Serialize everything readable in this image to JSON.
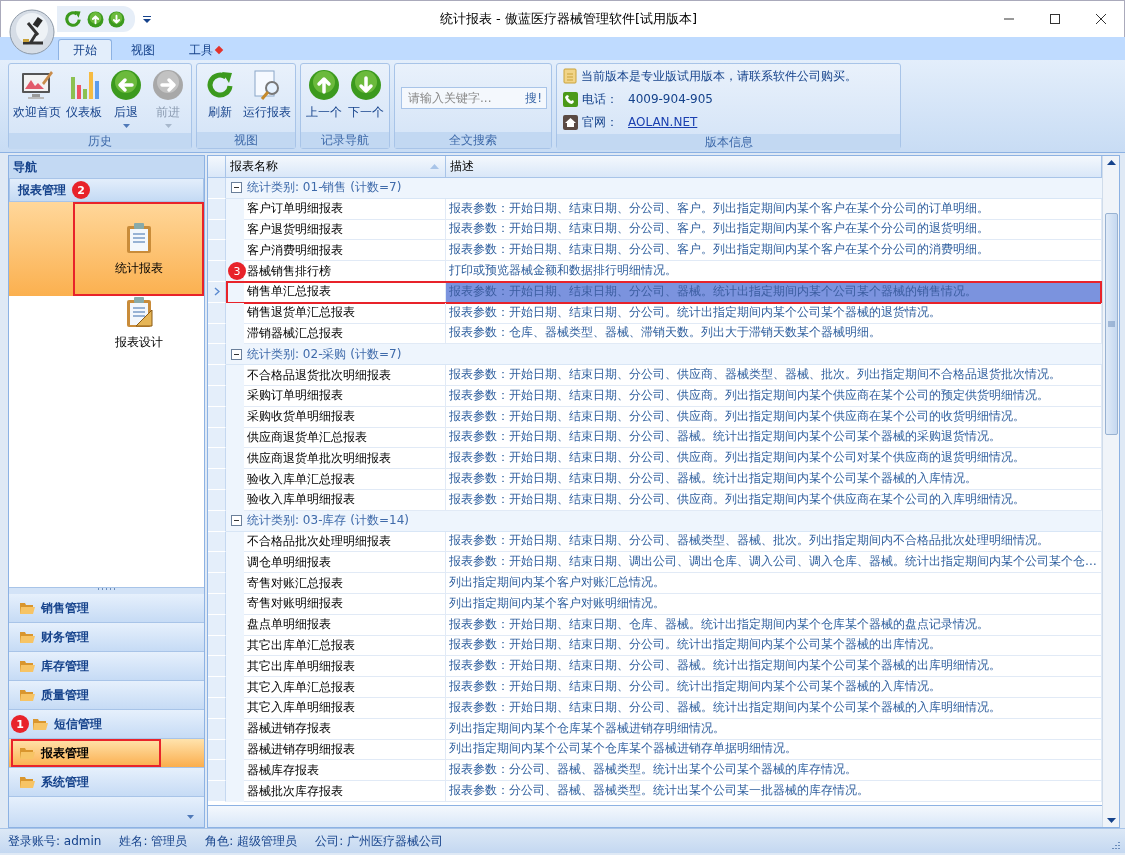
{
  "window": {
    "title": "统计报表 - 傲蓝医疗器械管理软件[试用版本]"
  },
  "ribbon": {
    "tabs": [
      {
        "label": "开始",
        "selected": true,
        "dot": false
      },
      {
        "label": "视图",
        "selected": false,
        "dot": false
      },
      {
        "label": "工具",
        "selected": false,
        "dot": true
      }
    ],
    "groups": [
      {
        "caption": "历史",
        "buttons": [
          {
            "label": "欢迎首页",
            "disabled": false,
            "dropdown": false
          },
          {
            "label": "仪表板",
            "disabled": false,
            "dropdown": false
          },
          {
            "label": "后退",
            "disabled": false,
            "dropdown": true
          },
          {
            "label": "前进",
            "disabled": true,
            "dropdown": true
          }
        ]
      },
      {
        "caption": "视图",
        "buttons": [
          {
            "label": "刷新",
            "disabled": false,
            "dropdown": false
          },
          {
            "label": "运行报表",
            "disabled": false,
            "dropdown": false
          }
        ]
      },
      {
        "caption": "记录导航",
        "buttons": [
          {
            "label": "上一个",
            "disabled": false,
            "dropdown": false
          },
          {
            "label": "下一个",
            "disabled": false,
            "dropdown": false
          }
        ]
      }
    ],
    "search": {
      "caption": "全文搜索",
      "placeholder": "请输入关键字...",
      "button": "搜!"
    },
    "version_info": {
      "caption": "版本信息",
      "message": "当前版本是专业版试用版本，请联系软件公司购买。",
      "phone_label": "电话：",
      "phone": "4009-904-905",
      "website_label": "官网：",
      "website": "AOLAN.NET"
    }
  },
  "navigation": {
    "title": "导航",
    "group": {
      "label": "报表管理",
      "badge": "2"
    },
    "items": [
      {
        "label": "统计报表",
        "selected": true,
        "highlighted": true
      },
      {
        "label": "报表设计",
        "selected": false,
        "highlighted": false
      }
    ],
    "modules": [
      {
        "label": "销售管理",
        "selected": false,
        "highlighted": false
      },
      {
        "label": "财务管理",
        "selected": false,
        "highlighted": false
      },
      {
        "label": "库存管理",
        "selected": false,
        "highlighted": false
      },
      {
        "label": "质量管理",
        "selected": false,
        "highlighted": false
      },
      {
        "label": "短信管理",
        "selected": false,
        "highlighted": false,
        "badge": "1"
      },
      {
        "label": "报表管理",
        "selected": true,
        "highlighted": true
      },
      {
        "label": "系统管理",
        "selected": false,
        "highlighted": false
      }
    ]
  },
  "table": {
    "columns": [
      "报表名称",
      "描述"
    ],
    "groups": [
      {
        "label": "统计类别: 01-销售 (计数=7)",
        "expanded": true,
        "rows": [
          {
            "name": "客户订单明细报表",
            "description": "报表参数：开始日期、结束日期、分公司、客户。列出指定期间内某个客户在某个分公司的订单明细。",
            "selected": false,
            "highlighted": false
          },
          {
            "name": "客户退货明细报表",
            "description": "报表参数：开始日期、结束日期、分公司、客户。列出指定期间内某个客户在某个分公司的退货明细。",
            "selected": false,
            "highlighted": false
          },
          {
            "name": "客户消费明细报表",
            "description": "报表参数：开始日期、结束日期、分公司、客户。列出指定期间内某个客户在某个分公司的消费明细。",
            "selected": false,
            "highlighted": false
          },
          {
            "name": "器械销售排行榜",
            "description": "打印或预览器械金额和数据排行明细情况。",
            "selected": false,
            "highlighted": false,
            "badge": "3"
          },
          {
            "name": "销售单汇总报表",
            "description": "报表参数：开始日期、结束日期、分公司、器械。统计出指定期间内某个公司某个器械的销售情况。",
            "selected": true,
            "highlighted": true
          },
          {
            "name": "销售退货单汇总报表",
            "description": "报表参数：开始日期、结束日期、分公司。统计出指定期间内某个公司某个器械的退货情况。",
            "selected": false,
            "highlighted": false
          },
          {
            "name": "滞销器械汇总报表",
            "description": "报表参数：仓库、器械类型、器械、滞销天数。列出大于滞销天数某个器械明细。",
            "selected": false,
            "highlighted": false
          }
        ]
      },
      {
        "label": "统计类别: 02-采购 (计数=7)",
        "expanded": true,
        "rows": [
          {
            "name": "不合格品退货批次明细报表",
            "description": "报表参数：开始日期、结束日期、分公司、供应商、器械类型、器械、批次。列出指定期间不合格品退货批次情况。",
            "selected": false,
            "highlighted": false
          },
          {
            "name": "采购订单明细报表",
            "description": "报表参数：开始日期、结束日期、分公司、供应商。列出指定期间内某个供应商在某个公司的预定供货明细情况。",
            "selected": false,
            "highlighted": false
          },
          {
            "name": "采购收货单明细报表",
            "description": "报表参数：开始日期、结束日期、分公司、供应商。列出指定期间内某个供应商在某个公司的收货明细情况。",
            "selected": false,
            "highlighted": false
          },
          {
            "name": "供应商退货单汇总报表",
            "description": "报表参数：开始日期、结束日期、分公司、器械。统计出指定期间内某个公司某个器械的采购退货情况。",
            "selected": false,
            "highlighted": false
          },
          {
            "name": "供应商退货单批次明细报表",
            "description": "报表参数：开始日期、结束日期、分公司、供应商。列出指定期间内某个公司对某个供应商的退货明细情况。",
            "selected": false,
            "highlighted": false
          },
          {
            "name": "验收入库单汇总报表",
            "description": "报表参数：开始日期、结束日期、分公司、器械。统计出指定期间内某个公司某个器械的入库情况。",
            "selected": false,
            "highlighted": false
          },
          {
            "name": "验收入库单明细报表",
            "description": "报表参数：开始日期、结束日期、分公司、供应商。列出指定期间内某个供应商在某个公司的入库明细情况。",
            "selected": false,
            "highlighted": false
          }
        ]
      },
      {
        "label": "统计类别: 03-库存 (计数=14)",
        "expanded": true,
        "rows": [
          {
            "name": "不合格品批次处理明细报表",
            "description": "报表参数：开始日期、结束日期、分公司、器械类型、器械、批次。列出指定期间内不合格品批次处理明细情况。",
            "selected": false,
            "highlighted": false
          },
          {
            "name": "调仓单明细报表",
            "description": "报表参数：开始日期、结束日期、调出公司、调出仓库、调入公司、调入仓库、器械。统计出指定期间内某个公司某个仓…",
            "selected": false,
            "highlighted": false
          },
          {
            "name": "寄售对账汇总报表",
            "description": "列出指定期间内某个客户对账汇总情况。",
            "selected": false,
            "highlighted": false
          },
          {
            "name": "寄售对账明细报表",
            "description": "列出指定期间内某个客户对账明细情况。",
            "selected": false,
            "highlighted": false
          },
          {
            "name": "盘点单明细报表",
            "description": "报表参数：开始日期、结束日期、仓库、器械。统计出指定期间内某个仓库某个器械的盘点记录情况。",
            "selected": false,
            "highlighted": false
          },
          {
            "name": "其它出库单汇总报表",
            "description": "报表参数：开始日期、结束日期、分公司。统计出指定期间内某个公司某个器械的出库情况。",
            "selected": false,
            "highlighted": false
          },
          {
            "name": "其它出库单明细报表",
            "description": "报表参数：开始日期、结束日期、分公司、器械。统计出指定期间内某个公司某个器械的出库明细情况。",
            "selected": false,
            "highlighted": false
          },
          {
            "name": "其它入库单汇总报表",
            "description": "报表参数：开始日期、结束日期、分公司。统计出指定期间内某个公司某个器械的入库情况。",
            "selected": false,
            "highlighted": false
          },
          {
            "name": "其它入库单明细报表",
            "description": "报表参数：开始日期、结束日期、分公司、器械。统计出指定期间内某个公司某个器械的入库明细情况。",
            "selected": false,
            "highlighted": false
          },
          {
            "name": "器械进销存报表",
            "description": "列出指定期间内某个仓库某个器械进销存明细情况。",
            "selected": false,
            "highlighted": false
          },
          {
            "name": "器械进销存明细报表",
            "description": "列出指定期间内某个公司某个仓库某个器械进销存单据明细情况。",
            "selected": false,
            "highlighted": false
          },
          {
            "name": "器械库存报表",
            "description": "报表参数：分公司、器械、器械类型。统计出某个公司某个器械的库存情况。",
            "selected": false,
            "highlighted": false
          },
          {
            "name": "器械批次库存报表",
            "description": "报表参数：分公司、器械、器械类型。统计出某个公司某一批器械的库存情况。",
            "selected": false,
            "highlighted": false
          }
        ]
      }
    ]
  },
  "status_bar": [
    "登录账号: admin",
    "姓名: 管理员",
    "角色: 超级管理员",
    "公司: 广州医疗器械公司"
  ]
}
